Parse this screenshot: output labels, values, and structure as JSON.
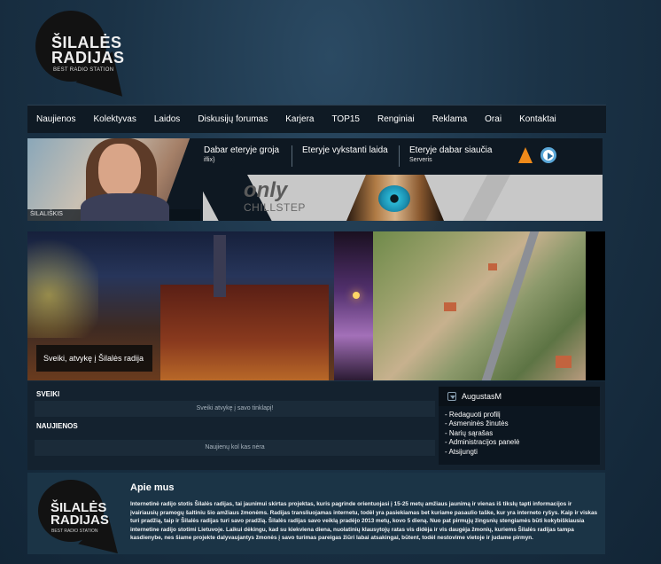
{
  "logo": {
    "line1": "ŠILALĖS",
    "line2": "RADIJAS",
    "tagline": "BEST RADIO STATION"
  },
  "nav": {
    "items": [
      "Naujienos",
      "Kolektyvas",
      "Laidos",
      "Diskusijų forumas",
      "Karjera",
      "TOP15",
      "Renginiai",
      "Reklama",
      "Orai",
      "Kontaktai"
    ]
  },
  "player": {
    "dj_label": "ŠILALIŠKIS",
    "now_playing": {
      "heading": "Dabar eteryje groja",
      "value": "iflix}"
    },
    "current_show": {
      "heading": "Eteryje vykstanti laida"
    },
    "streaming": {
      "heading": "Eteryje dabar siaučia",
      "value": "Serveris"
    },
    "icons": [
      "vlc-icon",
      "play-icon"
    ],
    "banner": {
      "word1": "only",
      "word2": "CHILLSTEP"
    }
  },
  "slider": {
    "caption": "Sveiki, atvykę į Šilalės radija"
  },
  "sections": {
    "welcome": {
      "title": "SVEIKI",
      "text": "Sveiki atvykę į savo tinklapį!"
    },
    "news": {
      "title": "NAUJIENOS",
      "text": "Naujienų kol kas nėra"
    }
  },
  "user_panel": {
    "username": "AugustasM",
    "links": [
      "- Redaguoti profilį",
      "- Asmeninės žinutės",
      "- Narių sąrašas",
      "- Administracijos panelė",
      "- Atsijungti"
    ]
  },
  "about": {
    "title": "Apie mus",
    "text": "Internetinė radijo stotis Šilalės radijas, tai jaunimui skirtas projektas, kuris pagrinde orientuojasi į 15-25 metų amžiaus jaunimą ir vienas iš tikslų tapti informacijos ir įvairiausių pramogų šaltiniu šio amžiaus žmonėms. Radijas transliuojamas internetu, todėl yra pasiekiamas bet kuriame pasaulio taške, kur yra interneto ryšys. Kaip ir viskas turi pradžią, taip ir Šilalės radijas turi savo pradžią. Šilalės radijas savo veiklą pradėjo 2013 metų, kovo 5 dieną. Nuo pat pirmųjų žingsnių stengiamės būti kokybiškiausia internetine radijo stotimi Lietuvoje. Laikui dėkingu, kad su kiekviena diena, nuolatinių klausytojų ratas vis didėja ir vis daugėja žmonių, kuriems Šilalės radijas tampa kasdienybe, nes šiame projekte dalyvaujantys žmonės į savo turimas pareigas žiūri labai atsakingai, būtent, todėl nestovime vietoje ir judame pirmyn."
  },
  "colors": {
    "background": "#1b3347",
    "nav_bg": "#0f1a24",
    "panel_bg": "#14222f",
    "about_bg": "#1b3446",
    "accent_orange": "#f08a1a"
  }
}
